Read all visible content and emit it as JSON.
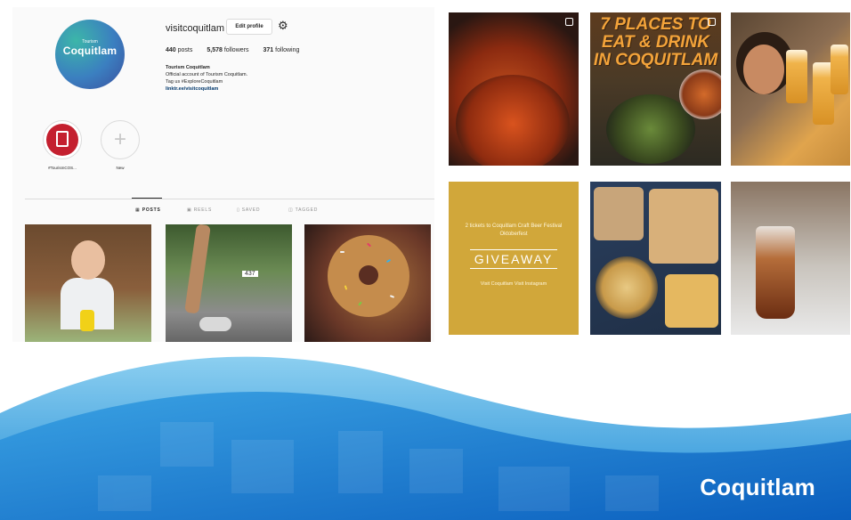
{
  "profile": {
    "username": "visitcoquitlam",
    "edit_label": "Edit profile",
    "avatar_top": "Tourism",
    "avatar_text": "Coquitlam",
    "posts_count": "440",
    "posts_label": "posts",
    "followers_count": "5,578",
    "followers_label": "followers",
    "following_count": "371",
    "following_label": "following",
    "name": "Tourism Coquitlam",
    "bio_line1": "Official account of Tourism Coquitlam.",
    "bio_line2": "Tag us #ExploreCoquitlam",
    "link": "linktr.ee/visitcoquitlam"
  },
  "highlights": [
    {
      "label": "#TourismCOS..."
    },
    {
      "label": "New"
    }
  ],
  "tabs": [
    {
      "label": "POSTS",
      "icon": "grid-icon",
      "active": true
    },
    {
      "label": "REELS",
      "icon": "reels-icon",
      "active": false
    },
    {
      "label": "SAVED",
      "icon": "bookmark-icon",
      "active": false
    },
    {
      "label": "TAGGED",
      "icon": "tag-icon",
      "active": false
    }
  ],
  "thumbs": {
    "stair_number": "437"
  },
  "posts": {
    "eat_drink_title_1": "7 PLACES TO",
    "eat_drink_title_2": "EAT & DRINK",
    "eat_drink_title_3": "IN COQUITLAM",
    "giveaway_top": "2 tickets to Coquitlam Craft Beer Festival Oktoberfest",
    "giveaway_mid": "GIVEAWAY",
    "giveaway_bottom": "Visit Coquitlam Visit Instagram"
  },
  "banner": {
    "brand": "Coquitlam"
  },
  "colors": {
    "banner_light": "#5fb0e8",
    "banner_dark": "#0a5cb8",
    "accent_red": "#c4202f"
  }
}
